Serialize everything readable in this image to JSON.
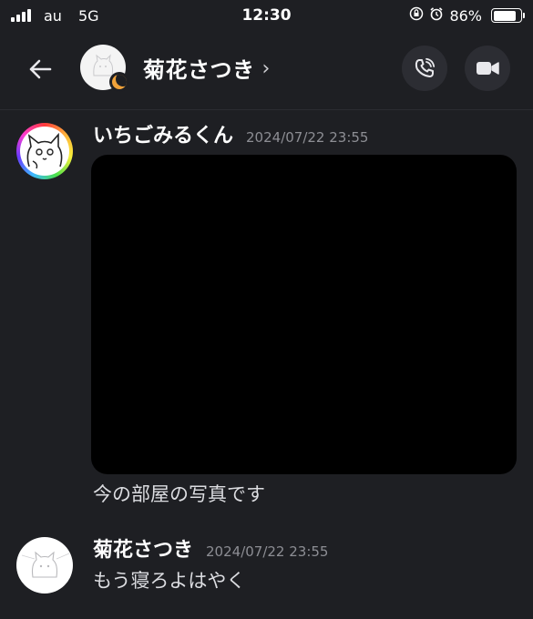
{
  "status_bar": {
    "carrier": "au",
    "network": "5G",
    "time": "12:30",
    "battery_percent": "86%",
    "battery_level": 0.86,
    "icons": [
      "orientation-lock-icon",
      "alarm-icon"
    ]
  },
  "header": {
    "contact_name": "菊花さつき",
    "chevron": "›",
    "icons": {
      "back": "arrow-left-icon",
      "call": "phone-icon",
      "video": "video-camera-icon",
      "status": "moon-icon"
    }
  },
  "messages": [
    {
      "author": "いちごみるくん",
      "timestamp": "2024/07/22 23:55",
      "attachment": "photo",
      "text": "今の部屋の写真です"
    },
    {
      "author": "菊花さつき",
      "timestamp": "2024/07/22 23:55",
      "text": "もう寝ろよはやく"
    }
  ],
  "colors": {
    "background": "#1e1f23",
    "button_bg": "#2c2d33",
    "status_moon": "#f0a23a",
    "timestamp": "#8d8e94"
  }
}
